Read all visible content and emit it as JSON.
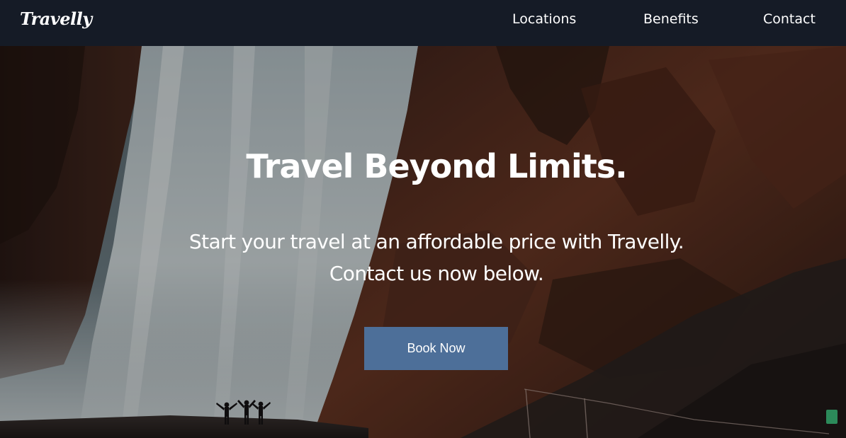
{
  "navbar": {
    "brand": "Travelly",
    "links": [
      {
        "label": "Locations"
      },
      {
        "label": "Benefits"
      },
      {
        "label": "Contact"
      }
    ]
  },
  "hero": {
    "title": "Travel Beyond Limits.",
    "subtitle_line1": "Start your travel at an affordable price with Travelly.",
    "subtitle_line2": "Contact us now below.",
    "cta_label": "Book Now"
  },
  "colors": {
    "navbar_bg": "#151b26",
    "cta_bg": "#4d6f99",
    "text": "#ffffff"
  },
  "icons": [
    "waterfall-hero-image",
    "feedback-widget-icon"
  ]
}
